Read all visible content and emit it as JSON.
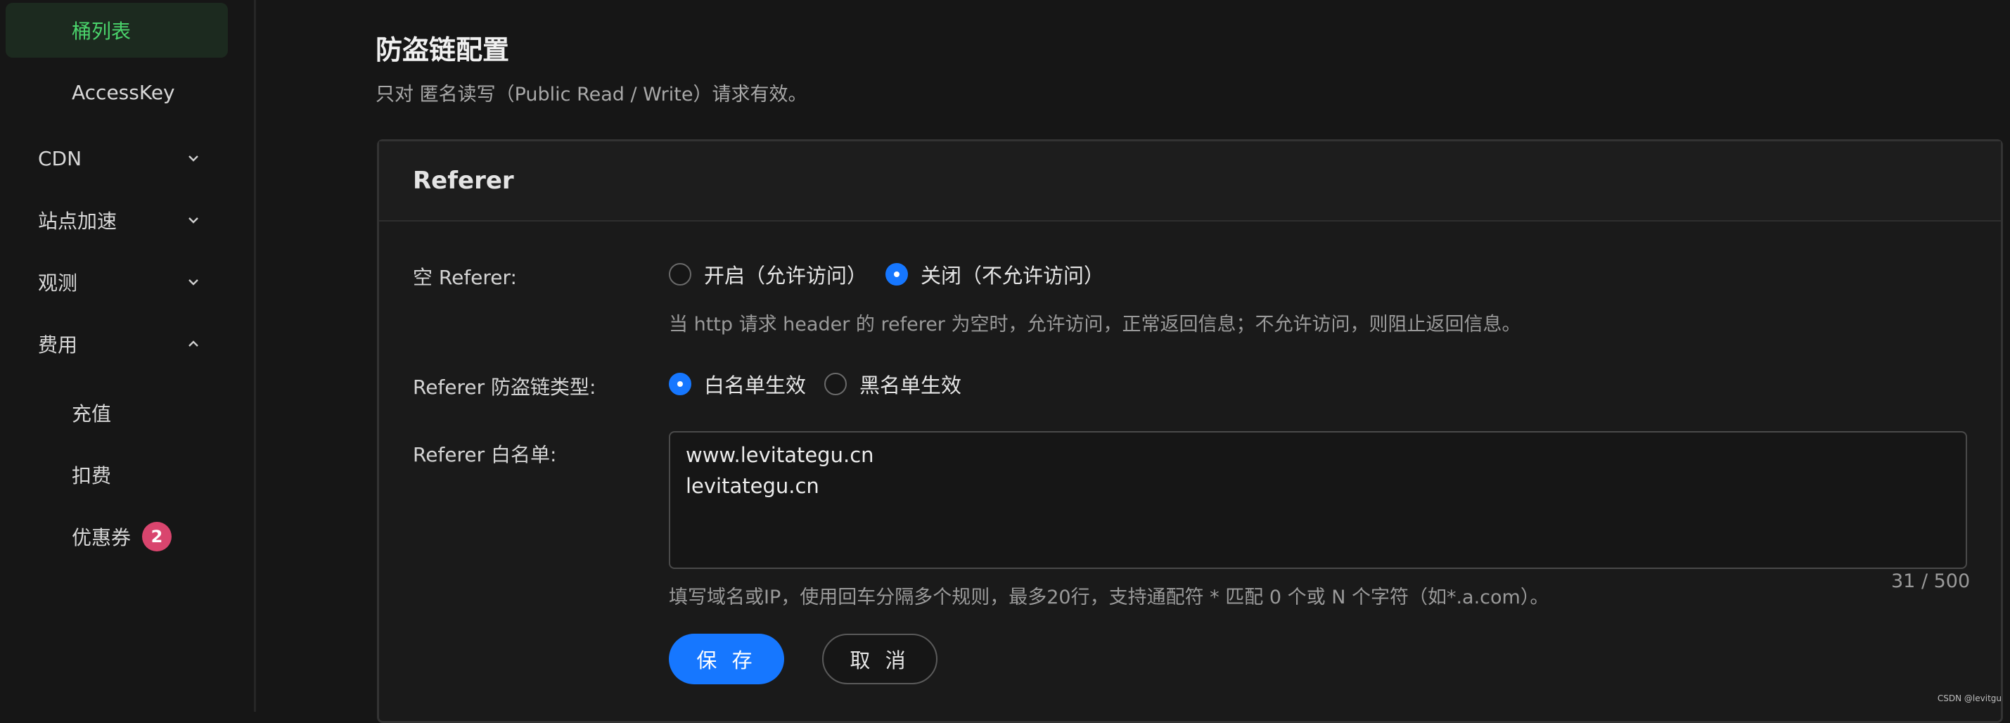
{
  "sidebar": {
    "items": [
      {
        "label": "桶列表",
        "active": true
      },
      {
        "label": "AccessKey"
      },
      {
        "label": "CDN",
        "chevron": "down"
      },
      {
        "label": "站点加速",
        "chevron": "down"
      },
      {
        "label": "观测",
        "chevron": "down"
      },
      {
        "label": "费用",
        "chevron": "up"
      },
      {
        "label": "充值"
      },
      {
        "label": "扣费"
      },
      {
        "label": "优惠券",
        "badge": "2"
      }
    ]
  },
  "page": {
    "title": "防盗链配置",
    "subtitle": "只对 匿名读写（Public Read / Write）请求有效。"
  },
  "card": {
    "header": "Referer",
    "empty_referer": {
      "label": "空 Referer:",
      "options": [
        "开启（允许访问）",
        "关闭（不允许访问）"
      ],
      "selected": 1,
      "hint": "当 http 请求 header 的 referer 为空时，允许访问，正常返回信息；不允许访问，则阻止返回信息。"
    },
    "referer_type": {
      "label": "Referer 防盗链类型:",
      "options": [
        "白名单生效",
        "黑名单生效"
      ],
      "selected": 0
    },
    "whitelist": {
      "label": "Referer 白名单:",
      "lines": [
        "www.levitategu.cn",
        "levitategu.cn"
      ],
      "counter": "31 / 500",
      "hint": "填写域名或IP，使用回车分隔多个规则，最多20行，支持通配符 * 匹配 0 个或 N 个字符（如*.a.com）。"
    },
    "buttons": {
      "save": "保 存",
      "cancel": "取 消"
    }
  },
  "watermark": "CSDN @levitgu",
  "colors": {
    "accent": "#1677ff",
    "active_green": "#4ad36b",
    "badge": "#d9456e"
  }
}
